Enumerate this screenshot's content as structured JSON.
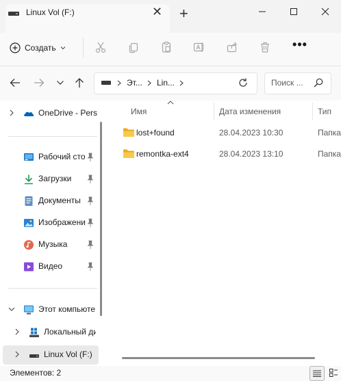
{
  "window": {
    "tab_title": "Linux Vol (F:)",
    "new_tab_symbol": "+",
    "close_tab_symbol": "✕"
  },
  "commandbar": {
    "create_label": "Создать",
    "more_label": "•••",
    "icons": [
      "cut-icon",
      "copy-icon",
      "paste-icon",
      "rename-icon",
      "share-icon",
      "delete-icon"
    ]
  },
  "address": {
    "crumbs": [
      "Эт...",
      "Lin..."
    ],
    "search_placeholder": "Поиск ..."
  },
  "sidebar": {
    "onedrive": "OneDrive - Pers",
    "quick": [
      {
        "label": "Рабочий сто",
        "icon": "desktop-icon"
      },
      {
        "label": "Загрузки",
        "icon": "downloads-icon"
      },
      {
        "label": "Документы",
        "icon": "documents-icon"
      },
      {
        "label": "Изображени",
        "icon": "pictures-icon"
      },
      {
        "label": "Музыка",
        "icon": "music-icon"
      },
      {
        "label": "Видео",
        "icon": "videos-icon"
      }
    ],
    "this_pc": "Этот компьюте",
    "local_disk": "Локальный ди",
    "linux_vol": "Linux Vol (F:)"
  },
  "columns": {
    "name": "Имя",
    "date": "Дата изменения",
    "type": "Тип"
  },
  "files": [
    {
      "name": "lost+found",
      "date": "28.04.2023 10:30",
      "type": "Папка"
    },
    {
      "name": "remontka-ext4",
      "date": "28.04.2023 13:10",
      "type": "Папка"
    }
  ],
  "status": {
    "text": "Элементов: 2"
  },
  "colors": {
    "folder": "#f6c744",
    "accent": "#0067c0",
    "background": "#f9f9f9"
  }
}
